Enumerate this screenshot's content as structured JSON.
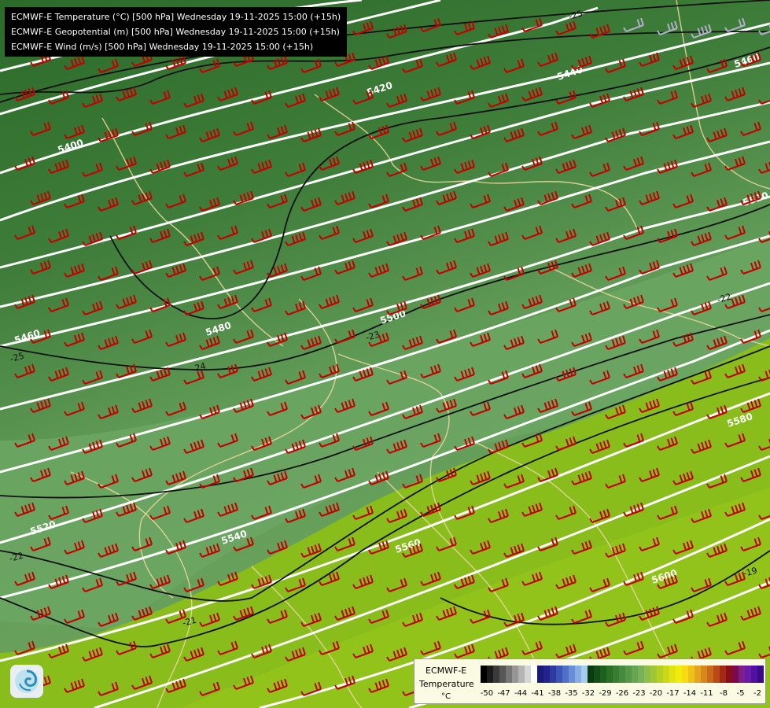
{
  "header": {
    "line1": "ECMWF-E Temperature (°C) [500 hPa] Wednesday 19-11-2025 15:00 (+15h)",
    "line2": "ECMWF-E Geopotential (m) [500 hPa] Wednesday 19-11-2025 15:00 (+15h)",
    "line3": "ECMWF-E Wind (m/s) [500 hPa] Wednesday 19-11-2025 15:00 (+15h)"
  },
  "legend": {
    "model": "ECMWF-E",
    "parameter": "Temperature",
    "unit": "°C",
    "ticks": [
      "-50",
      "-47",
      "-44",
      "-41",
      "-38",
      "-35",
      "-32",
      "-29",
      "-26",
      "-23",
      "-20",
      "-17",
      "-14",
      "-11",
      "-8",
      "-5",
      "-2"
    ],
    "colors": [
      "#000000",
      "#1c1c1c",
      "#3a3a3a",
      "#575757",
      "#767676",
      "#959595",
      "#b4b4b4",
      "#d6d6d6",
      "#ffffff",
      "#1a1a7a",
      "#23238c",
      "#2d3aa0",
      "#3c55b4",
      "#4f70c6",
      "#6a8ed6",
      "#86aee4",
      "#a6cdef",
      "#0a3a10",
      "#154d17",
      "#1f5f1e",
      "#2b6f26",
      "#3a7c33",
      "#478a3e",
      "#56984a",
      "#67a555",
      "#78b15c",
      "#8ebd4a",
      "#a0c535",
      "#b5cf22",
      "#cbd818",
      "#e0e410",
      "#f2ec0a",
      "#f7dd10",
      "#eec21a",
      "#e3a51d",
      "#d6881d",
      "#c96a1a",
      "#b94a16",
      "#a22a14",
      "#8b0d1a",
      "#7a0a4a",
      "#7b1f8a",
      "#6a1aa8",
      "#5210a0",
      "#3a0a8a"
    ]
  },
  "map": {
    "geopotential_labels": [
      "5400",
      "5420",
      "5440",
      "5460",
      "5460",
      "5480",
      "5500",
      "5520",
      "5520",
      "5540",
      "5560",
      "5580",
      "5600"
    ],
    "temperature_labels": [
      "-25",
      "-25",
      "-24",
      "-22",
      "-22",
      "-21",
      "-19",
      "-23"
    ],
    "colors": {
      "cold_green": "#2f6a2b",
      "mid_green": "#5e9a55",
      "pale": "#7bb06c",
      "warm": "#8fc21c",
      "barb": "#c00000",
      "isohypse": "#ffffff",
      "isotherm": "#000000",
      "border": "#e8d79a"
    }
  }
}
